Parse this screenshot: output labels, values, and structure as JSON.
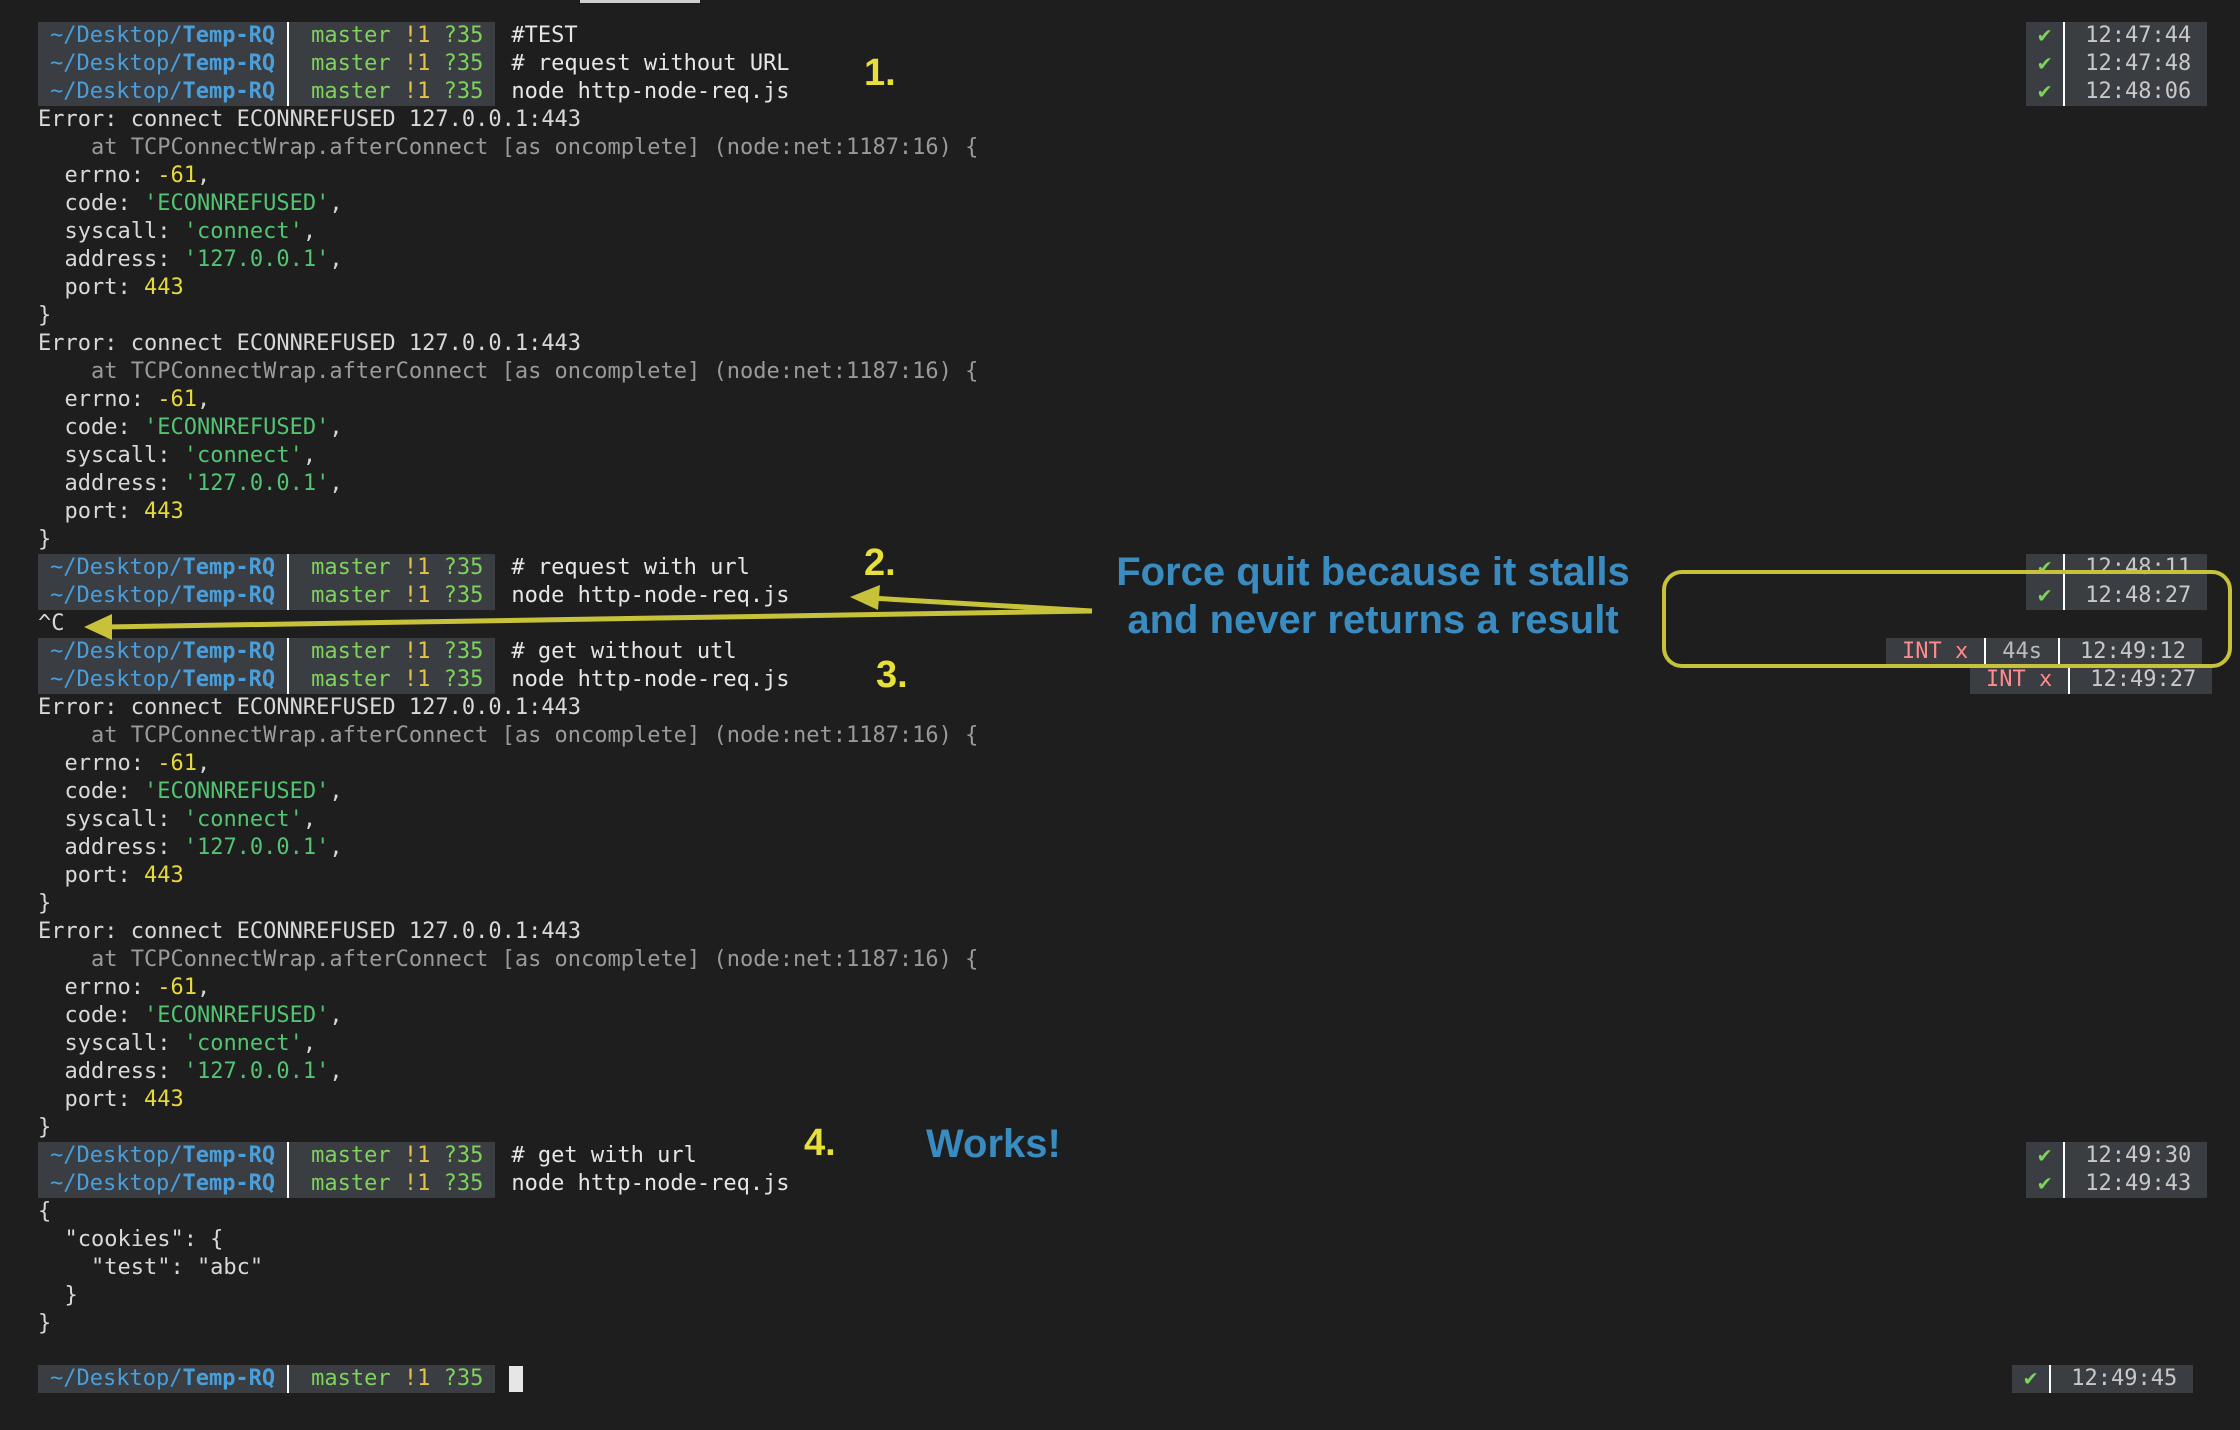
{
  "prompt": {
    "dir_prefix": "~/Desktop/",
    "dir_name": "Temp-RQ",
    "branch": "master",
    "modified": "!1",
    "untracked": "?35"
  },
  "commands": [
    "#TEST",
    "# request without URL",
    "node http-node-req.js",
    "# request with url",
    "node http-node-req.js",
    "# get without utl",
    "node http-node-req.js",
    "# get with url",
    "node http-node-req.js"
  ],
  "error": {
    "header": "Error: connect ECONNREFUSED 127.0.0.1:443",
    "stack": "    at TCPConnectWrap.afterConnect [as oncomplete] (node:net:1187:16) {",
    "errno_key": "  errno: ",
    "errno_val": "-61",
    "code_key": "  code: ",
    "code_val": "'ECONNREFUSED'",
    "syscall_key": "  syscall: ",
    "syscall_val": "'connect'",
    "address_key": "  address: ",
    "address_val": "'127.0.0.1'",
    "port_key": "  port: ",
    "port_val": "443",
    "close": "}"
  },
  "interrupt": "^C",
  "json_output": [
    "{",
    "  \"cookies\": {",
    "    \"test\": \"abc\"",
    "  }",
    "}"
  ],
  "right_status": {
    "check": "✔",
    "int": "INT x",
    "duration": "44s",
    "times": [
      "12:47:44",
      "12:47:48",
      "12:48:06",
      "12:48:11",
      "12:48:27",
      "12:49:12",
      "12:49:27",
      "12:49:30",
      "12:49:43",
      "12:49:45"
    ]
  },
  "annotations": {
    "n1": "1.",
    "n2": "2.",
    "n3": "3.",
    "n4": "4.",
    "force_quit": "Force quit because it stalls\nand never returns a result",
    "works": "Works!"
  },
  "colors": {
    "background": "#1e1e1e",
    "segment": "#3a3d42",
    "dir": "#4a9eda",
    "git": "#7ed35b",
    "string": "#52c472",
    "number": "#e6d93a",
    "annotation_yellow": "#e8e03a",
    "annotation_blue": "#3a8bc0",
    "int_red": "#ff8a8a"
  }
}
